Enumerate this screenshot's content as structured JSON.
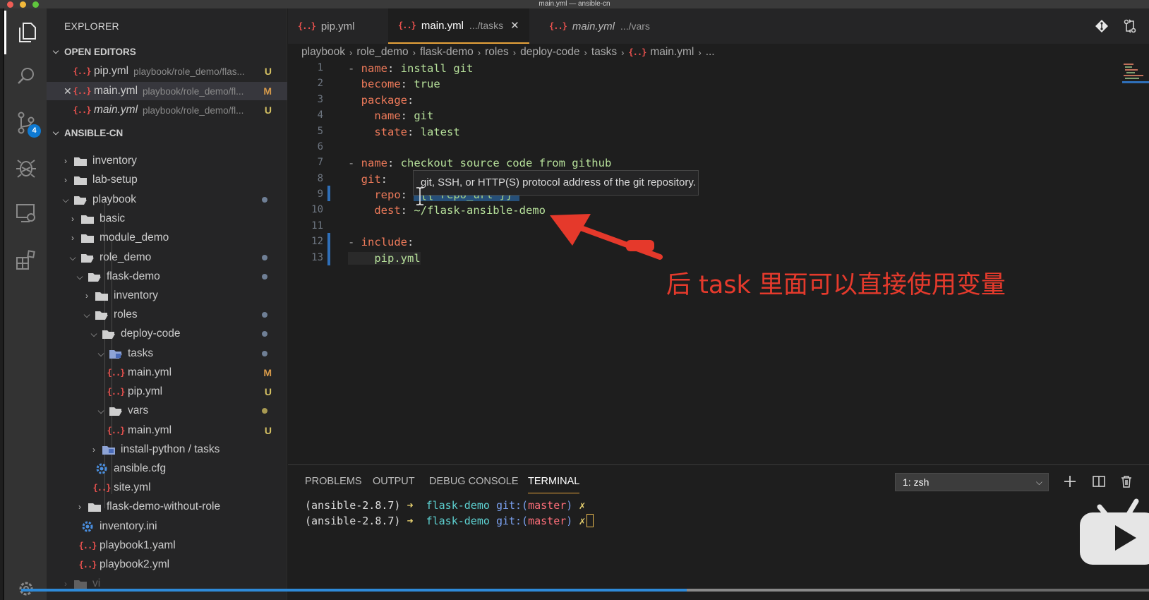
{
  "window": {
    "title": "main.yml — ansible-cn"
  },
  "colors": {
    "accent": "#e7a33a",
    "brace_icon": "#e8514e",
    "untracked": "#d3bf62",
    "modified": "#d79a4a",
    "annotation": "#e53a2c"
  },
  "activity": {
    "scm_badge": "4",
    "icons": [
      "files-icon",
      "search-icon",
      "source-control-icon",
      "debug-icon",
      "remote-explorer-icon",
      "extensions-icon",
      "settings-gear-icon"
    ]
  },
  "sidebar": {
    "title": "EXPLORER",
    "open_editors": {
      "label": "OPEN EDITORS",
      "items": [
        {
          "name": "pip.yml",
          "path": "playbook/role_demo/flas...",
          "status": "U"
        },
        {
          "name": "main.yml",
          "path": "playbook/role_demo/fl...",
          "status": "M",
          "close": "✕"
        },
        {
          "name": "main.yml",
          "path": "playbook/role_demo/fl...",
          "status": "U"
        }
      ]
    },
    "workspace": {
      "label": "ANSIBLE-CN",
      "items": [
        {
          "name": "inventory"
        },
        {
          "name": "lab-setup"
        },
        {
          "name": "playbook"
        },
        {
          "name": "basic"
        },
        {
          "name": "module_demo"
        },
        {
          "name": "role_demo"
        },
        {
          "name": "flask-demo"
        },
        {
          "name": "inventory"
        },
        {
          "name": "roles"
        },
        {
          "name": "deploy-code"
        },
        {
          "name": "tasks"
        },
        {
          "name": "main.yml",
          "status": "M"
        },
        {
          "name": "pip.yml",
          "status": "U"
        },
        {
          "name": "vars"
        },
        {
          "name": "main.yml",
          "status": "U"
        },
        {
          "name": "install-python / tasks"
        },
        {
          "name": "ansible.cfg"
        },
        {
          "name": "site.yml"
        },
        {
          "name": "flask-demo-without-role"
        },
        {
          "name": "inventory.ini"
        },
        {
          "name": "playbook1.yaml"
        },
        {
          "name": "playbook2.yml"
        },
        {
          "name": "vi"
        }
      ]
    }
  },
  "tabs": [
    {
      "label": "pip.yml",
      "sub": ""
    },
    {
      "label": "main.yml",
      "sub": ".../tasks",
      "close": "✕"
    },
    {
      "label": "main.yml",
      "sub": ".../vars"
    }
  ],
  "breadcrumb": [
    "playbook",
    "role_demo",
    "flask-demo",
    "roles",
    "deploy-code",
    "tasks",
    "main.yml",
    "..."
  ],
  "editor": {
    "line_numbers": [
      "1",
      "2",
      "3",
      "4",
      "5",
      "6",
      "7",
      "8",
      "9",
      "10",
      "11",
      "12",
      "13"
    ],
    "lines": {
      "l1_key": "name",
      "l1_val": "install git",
      "l2_key": "become",
      "l2_val": "true",
      "l3_key": "package",
      "l4_key": "name",
      "l4_val": "git",
      "l5_key": "state",
      "l5_val": "latest",
      "l7_key": "name",
      "l7_val": "checkout source code from github",
      "l8_key": "git",
      "l9_key": "repo",
      "l9_val": "'{{ repo_url }}'",
      "l10_key": "dest",
      "l10_val": "~/flask-ansible-demo",
      "l12_key": "include",
      "l13_val": "pip.yml"
    },
    "hover_tooltip": "git, SSH, or HTTP(S) protocol address of the git repository.",
    "annotation": "后 task 里面可以直接使用变量"
  },
  "panel": {
    "tabs": [
      "PROBLEMS",
      "OUTPUT",
      "DEBUG CONSOLE",
      "TERMINAL"
    ],
    "terminal_select": "1: zsh",
    "terminal_lines": [
      {
        "env": "(ansible-2.8.7)",
        "arrow": "➜",
        "dir": "flask-demo",
        "git": "git:(",
        "branch": "master",
        "close": ")",
        "mark": "✗"
      },
      {
        "env": "(ansible-2.8.7)",
        "arrow": "➜",
        "dir": "flask-demo",
        "git": "git:(",
        "branch": "master",
        "close": ")",
        "mark": "✗"
      }
    ]
  },
  "video": {
    "progress": 0.59
  }
}
